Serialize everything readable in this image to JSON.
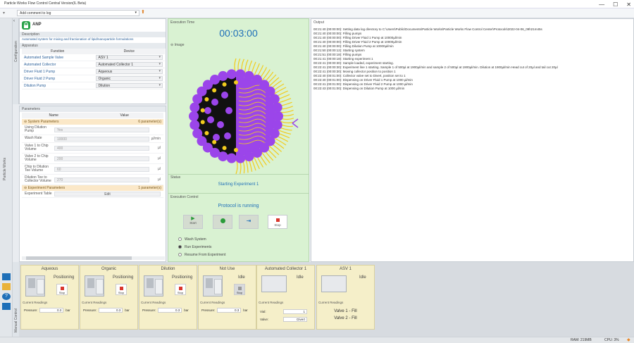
{
  "app": {
    "title": "Particle Works Flow Control Central Version(IL Beta)"
  },
  "window": {
    "min": "—",
    "max": "☐",
    "close": "✕"
  },
  "toolbar": {
    "comment_placeholder": "Add comment to log"
  },
  "left_strip": {
    "label": "Particle Works"
  },
  "config": {
    "tab_label": "Configuration",
    "protocol_name": "ANP",
    "description_label": "Description",
    "description_text": "Automated system for mixing and fractionation of lipid/nanoparticle formulations",
    "apparatus_label": "Apparatus",
    "apparatus_headers": [
      "Function",
      "Device"
    ],
    "apparatus_rows": [
      {
        "function": "Automated Sample Valve",
        "device": "ASV 1"
      },
      {
        "function": "Automated Collector",
        "device": "Automated Collector 1"
      },
      {
        "function": "Driver Fluid 1 Pump",
        "device": "Aqueous"
      },
      {
        "function": "Driver Fluid 2 Pump",
        "device": "Organic"
      },
      {
        "function": "Dilution Pump",
        "device": "Dilution"
      }
    ],
    "parameters_label": "Parameters",
    "param_headers": [
      "Name",
      "Value"
    ],
    "system_group": {
      "name": "System Parameters",
      "count": "6 parameter(s)"
    },
    "system_params": [
      {
        "name": "Using Dilution Pump",
        "value": "Yes",
        "unit": ""
      },
      {
        "name": "Wash Rate",
        "value": "10000",
        "unit": "µl/min"
      },
      {
        "name": "Valve 1 to Chip Volume",
        "value": "400",
        "unit": "µl"
      },
      {
        "name": "Valve 2 to Chip Volume",
        "value": "200",
        "unit": "µl"
      },
      {
        "name": "Chip to Dilution Tee Volume",
        "value": "60",
        "unit": "µl"
      },
      {
        "name": "Dilution Tee to Collector Volume",
        "value": "270",
        "unit": "µl"
      }
    ],
    "experiment_group": {
      "name": "Experiment Parameters",
      "count": "1 parameter(s)"
    },
    "experiment_params": [
      {
        "name": "Experiment Table",
        "value": "Edit"
      }
    ]
  },
  "execution": {
    "time_label": "Execution Time",
    "time": "00:03:00",
    "image_label": "Image",
    "status_label": "Status",
    "status": "Starting Experiment 1",
    "control_label": "Execution Control",
    "protocol_state": "Protocol is running",
    "buttons": {
      "start": "Start",
      "pause": "",
      "skip": "",
      "stop": "Stop"
    },
    "radio_options": [
      "Wash System",
      "Run Experiments",
      "Resume From Experiment"
    ],
    "radio_selected": 1
  },
  "output": {
    "label": "Output",
    "lines": [
      "00:21:40 (00:00:00): Setting data log directory to C:\\Users\\Public\\Documents\\Particle Works\\Particle Works Flow Control Center\\Protocols\\2022-04-06_09h21m45s",
      "00:21:40 (00:00:00): Filling pumps",
      "00:21:40 (00:00:00): Filling Driver Fluid 1 Pump at 10000µl/min",
      "00:21:40 (00:00:00): Filling Driver Fluid 2 Pump at 10000µl/min",
      "00:21:40 (00:00:00): Filling Dilution Pump at 10000µl/min",
      "00:21:50 (00:00:12): Starting system",
      "00:21:51 (00:00:18): Filling pumps",
      "00:21:41 (00:00:18): Starting experiment 1",
      "00:22:41 (00:00:30): Sample loaded, experiment starting.",
      "00:22:41 (00:00:30): Experiment line 1 starting. Sample 1 of 500µl at 1900µl/min and sample 2 of 500µl at 1900µl/min. Dilution at 1900µl/min Head cut of 20µl and tail cut 20µl",
      "00:22:41 (00:00:30): Moving collector position to position 1",
      "00:22:40 (00:01:00): Collector valve set to Divert, position set to 1",
      "00:22:40 (00:01:00): Dispensing on Driver Fluid 1 Pump at 1000 µl/min",
      "00:22:41 (00:01:00): Dispensing on Driver Fluid 2 Pump at 1000 µl/min",
      "00:22:43 (00:01:00): Dispensing on Dilution Pump at 1000 µl/min"
    ]
  },
  "manual_control": {
    "label": "Manual Control"
  },
  "devices": [
    {
      "name": "Aqueous",
      "state": "Positioning",
      "stop": "Stop",
      "readings": "Current Readings",
      "pressure_label": "Pressure:",
      "pressure": "0.3",
      "unit": "bar"
    },
    {
      "name": "Organic",
      "state": "Positioning",
      "stop": "Stop",
      "readings": "Current Readings",
      "pressure_label": "Pressure:",
      "pressure": "0.3",
      "unit": "bar"
    },
    {
      "name": "Dilution",
      "state": "Positioning",
      "stop": "Stop",
      "readings": "Current Readings",
      "pressure_label": "Pressure:",
      "pressure": "0.3",
      "unit": "bar"
    },
    {
      "name": "Not Use",
      "state": "Idle",
      "stop": "Stop",
      "readings": "Current Readings",
      "pressure_label": "Pressure:",
      "pressure": "0.3",
      "unit": "bar"
    }
  ],
  "collector": {
    "name": "Automated Collector 1",
    "state": "Idle",
    "readings": "Current Readings",
    "vial_label": "Vial:",
    "vial": "1",
    "valve_label": "Valve:",
    "valve": "Divert"
  },
  "asv": {
    "name": "ASV 1",
    "state": "Idle",
    "readings": "Current Readings",
    "valve1": "Valve 1 - Fill",
    "valve2": "Valve 2 - Fill"
  },
  "statusbar": {
    "ram": "RAM: 219MB",
    "cpu": "CPU: 3%"
  },
  "colors": {
    "accent": "#1e6fb8",
    "running": "#2a9c3a",
    "particle": "#9b45ea",
    "lipid_tail": "#f2cc1e"
  }
}
